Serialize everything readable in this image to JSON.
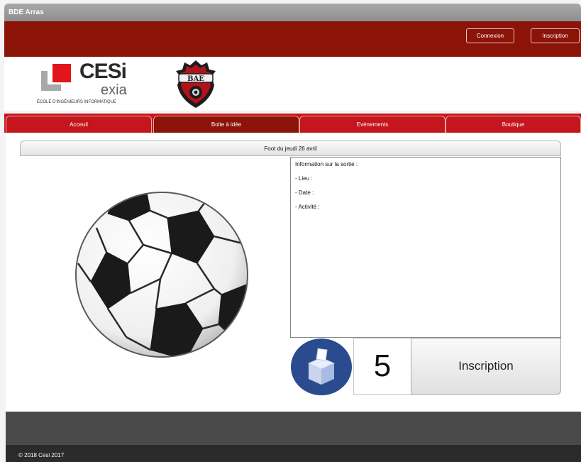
{
  "window": {
    "title": "BDE Arras"
  },
  "header": {
    "login_label": "Connexion",
    "signup_label": "Inscription"
  },
  "logos": {
    "cesi_main": "CESi",
    "cesi_sub": "exia",
    "cesi_tagline": "ÉCOLE D'INGÉNIEURS INFORMATIQUE",
    "bde_text": "BAE"
  },
  "nav": {
    "tabs": [
      {
        "label": "Acceuil"
      },
      {
        "label": "Boite à idée",
        "active": true
      },
      {
        "label": "Evénements"
      },
      {
        "label": "Boutique"
      }
    ]
  },
  "outing": {
    "title": "Foot du jeudi 26 avril",
    "info_heading": "Information sur la sortie :",
    "info_lines": [
      "- Lieu :",
      "- Date :",
      "- Activité :"
    ],
    "vote_count": "5",
    "signup_label": "Inscription"
  },
  "footer": {
    "copyright": "© 2018 Cesi 2017"
  },
  "colors": {
    "primary_dark": "#8b1308",
    "primary": "#c4161c",
    "footer": "#4a4a4a",
    "footer_dark": "#2b2b2b",
    "ballot_blue": "#2a4c8f"
  },
  "icons": {
    "ball": "soccer-ball-icon",
    "ballot": "ballot-box-icon"
  }
}
